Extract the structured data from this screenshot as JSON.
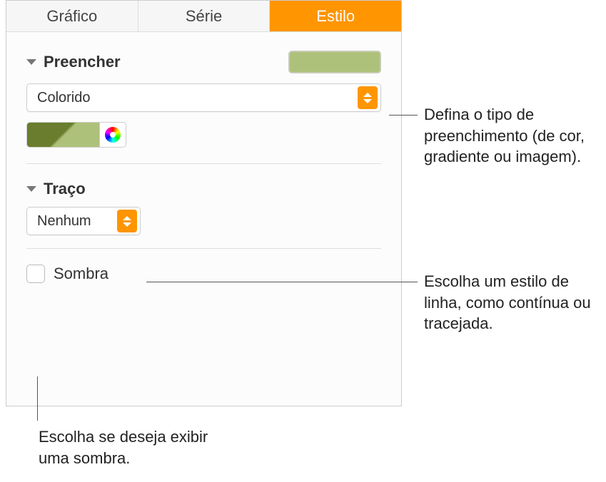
{
  "tabs": {
    "chart": "Gráfico",
    "series": "Série",
    "style": "Estilo"
  },
  "fill": {
    "title": "Preencher",
    "type_label": "Colorido"
  },
  "stroke": {
    "title": "Traço",
    "style_label": "Nenhum"
  },
  "shadow": {
    "label": "Sombra"
  },
  "callouts": {
    "fill": "Defina o tipo de preenchimento (de cor, gradiente ou imagem).",
    "stroke": "Escolha um estilo de linha, como contínua ou tracejada.",
    "shadow": "Escolha se deseja exibir uma sombra."
  },
  "colors": {
    "accent": "#ff9500",
    "swatch": "#aec17a",
    "swatch_dark": "#6a7d2e"
  }
}
